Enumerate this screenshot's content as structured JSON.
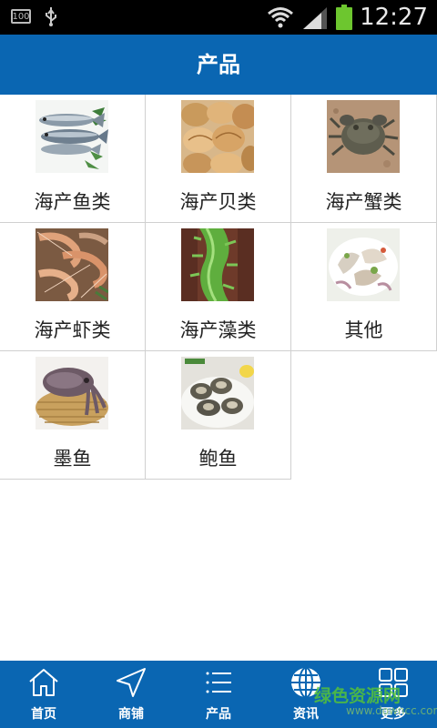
{
  "status": {
    "time": "12:27",
    "battery_small": "100"
  },
  "header": {
    "title": "产品"
  },
  "products": [
    {
      "label": "海产鱼类",
      "icon": "fish-photo"
    },
    {
      "label": "海产贝类",
      "icon": "clam-photo"
    },
    {
      "label": "海产蟹类",
      "icon": "crab-photo"
    },
    {
      "label": "海产虾类",
      "icon": "shrimp-photo"
    },
    {
      "label": "海产藻类",
      "icon": "seaweed-photo"
    },
    {
      "label": "其他",
      "icon": "seafood-dish-photo"
    },
    {
      "label": "墨鱼",
      "icon": "cuttlefish-photo"
    },
    {
      "label": "鲍鱼",
      "icon": "abalone-photo"
    }
  ],
  "nav": [
    {
      "label": "首页",
      "icon": "home-icon"
    },
    {
      "label": "商铺",
      "icon": "navigation-icon"
    },
    {
      "label": "产品",
      "icon": "list-icon"
    },
    {
      "label": "资讯",
      "icon": "globe-icon"
    },
    {
      "label": "更多",
      "icon": "grid-icon"
    }
  ],
  "watermark": {
    "text": "绿色资源网",
    "url": "www.downcc.com"
  },
  "colors": {
    "primary": "#0a66b2",
    "status_bar": "#000000",
    "divider": "#d0d0d0",
    "battery": "#6dc62f"
  }
}
